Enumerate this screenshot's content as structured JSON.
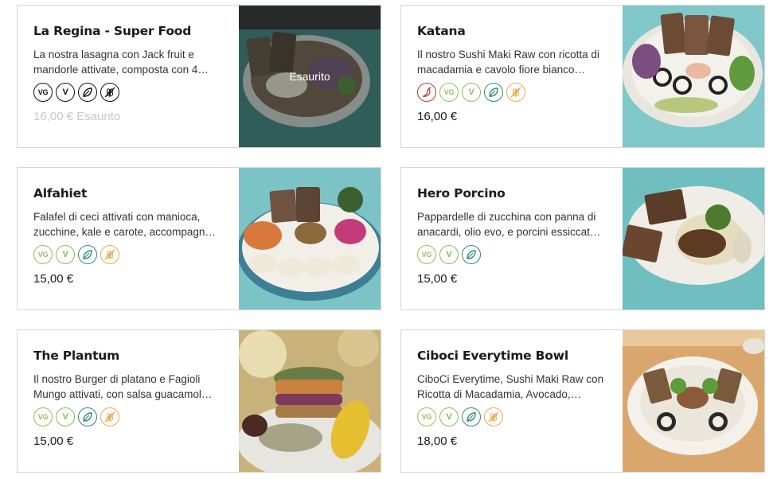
{
  "colors": {
    "vg": "#9aba5c",
    "v": "#8fb85a",
    "vegan_leaf": "#2e8a7a",
    "gluten_free": "#e8a94e",
    "spicy": "#c0392b",
    "black": "#111111"
  },
  "items": [
    {
      "title": "La Regina - Super Food",
      "description": "La nostra lasagna con Jack fruit e mandorle attivate, composta con 4…",
      "labels": [
        {
          "type": "vg",
          "text": "VG",
          "icon": "vegetarian-icon"
        },
        {
          "type": "v",
          "text": "V",
          "icon": "vegan-icon"
        },
        {
          "type": "leaf",
          "icon": "leaf-icon"
        },
        {
          "type": "gf",
          "icon": "gluten-free-icon"
        }
      ],
      "price": "16,00 € Esaurito",
      "sold_out": true,
      "overlay_text": "Esaurito",
      "photo_bg": "#2f6e6a"
    },
    {
      "title": "Katana",
      "description": "Il nostro Sushi Maki Raw con ricotta di macadamia e cavolo fiore bianco…",
      "labels": [
        {
          "type": "spicy",
          "icon": "chili-pepper-icon"
        },
        {
          "type": "vg",
          "text": "VG",
          "icon": "vegetarian-icon"
        },
        {
          "type": "v",
          "text": "V",
          "icon": "vegan-icon"
        },
        {
          "type": "leaf",
          "icon": "leaf-icon"
        },
        {
          "type": "gf",
          "icon": "gluten-free-icon"
        }
      ],
      "price": "16,00 €",
      "sold_out": false,
      "photo_bg": "#7fc7c9"
    },
    {
      "title": "Alfahiet",
      "description": "Falafel di ceci attivati con manioca, zucchine, kale e carote, accompagn…",
      "labels": [
        {
          "type": "vg",
          "text": "VG",
          "icon": "vegetarian-icon"
        },
        {
          "type": "v",
          "text": "V",
          "icon": "vegan-icon"
        },
        {
          "type": "leaf",
          "icon": "leaf-icon"
        },
        {
          "type": "gf",
          "icon": "gluten-free-icon"
        }
      ],
      "price": "15,00 €",
      "sold_out": false,
      "photo_bg": "#7cc3c6"
    },
    {
      "title": "Hero Porcino",
      "description": "Pappardelle di zucchina con panna di anacardi, olio evo, e porcini essiccat…",
      "labels": [
        {
          "type": "vg",
          "text": "VG",
          "icon": "vegetarian-icon"
        },
        {
          "type": "v",
          "text": "V",
          "icon": "vegan-icon"
        },
        {
          "type": "leaf",
          "icon": "leaf-icon"
        }
      ],
      "price": "15,00 €",
      "sold_out": false,
      "photo_bg": "#6fbec0"
    },
    {
      "title": "The Plantum",
      "description": "Il nostro Burger di platano e Fagioli Mungo attivati, con salsa guacamol…",
      "labels": [
        {
          "type": "vg",
          "text": "VG",
          "icon": "vegetarian-icon"
        },
        {
          "type": "v",
          "text": "V",
          "icon": "vegan-icon"
        },
        {
          "type": "leaf",
          "icon": "leaf-icon"
        },
        {
          "type": "gf",
          "icon": "gluten-free-icon"
        }
      ],
      "price": "15,00 €",
      "sold_out": false,
      "photo_bg": "#c9b27a"
    },
    {
      "title": "Ciboci Everytime Bowl",
      "description": "CiboCi Everytime, Sushi Maki Raw con Ricotta di Macadamia, Avocado,…",
      "labels": [
        {
          "type": "vg",
          "text": "VG",
          "icon": "vegetarian-icon"
        },
        {
          "type": "v",
          "text": "V",
          "icon": "vegan-icon"
        },
        {
          "type": "leaf",
          "icon": "leaf-icon"
        },
        {
          "type": "gf",
          "icon": "gluten-free-icon"
        }
      ],
      "price": "18,00 €",
      "sold_out": false,
      "photo_bg": "#d9a76e"
    }
  ]
}
